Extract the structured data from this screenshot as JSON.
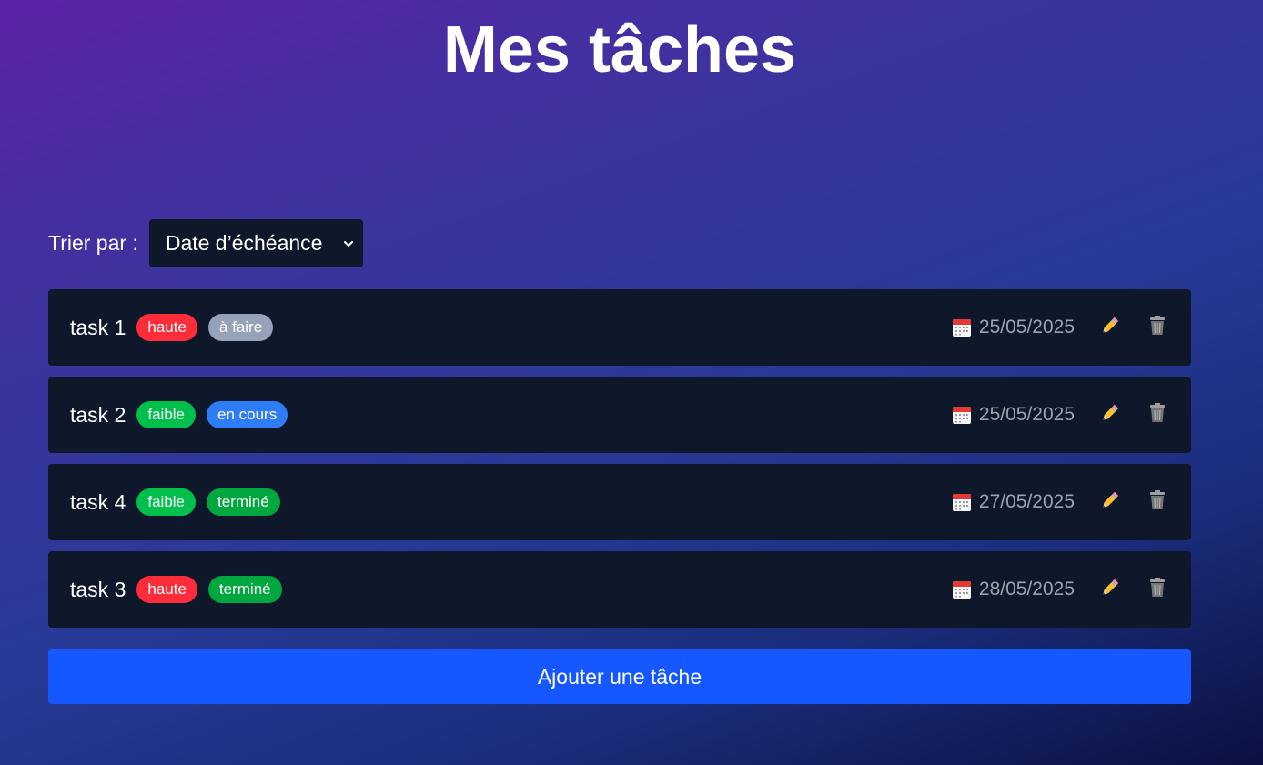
{
  "header": {
    "title": "Mes tâches"
  },
  "sort": {
    "label": "Trier par :",
    "selected": "Date d’échéance"
  },
  "colors": {
    "card_bg": "#0f172a",
    "priority_haute": "#ff2d3a",
    "priority_faible": "#00c04b",
    "status_a_faire": "#94a3b8",
    "status_en_cours": "#2e7cf6",
    "status_termine": "#00a63e",
    "date_text": "#9ca3af",
    "add_button": "#1558ff"
  },
  "tasks": [
    {
      "title": "task 1",
      "priority": "haute",
      "status": "à faire",
      "due_date": "25/05/2025"
    },
    {
      "title": "task 2",
      "priority": "faible",
      "status": "en cours",
      "due_date": "25/05/2025"
    },
    {
      "title": "task 4",
      "priority": "faible",
      "status": "terminé",
      "due_date": "27/05/2025"
    },
    {
      "title": "task 3",
      "priority": "haute",
      "status": "terminé",
      "due_date": "28/05/2025"
    }
  ],
  "task_icons": {
    "date": "calendar-icon",
    "edit": "pencil-icon",
    "delete": "trash-icon"
  },
  "actions": {
    "add_task_label": "Ajouter une tâche"
  }
}
